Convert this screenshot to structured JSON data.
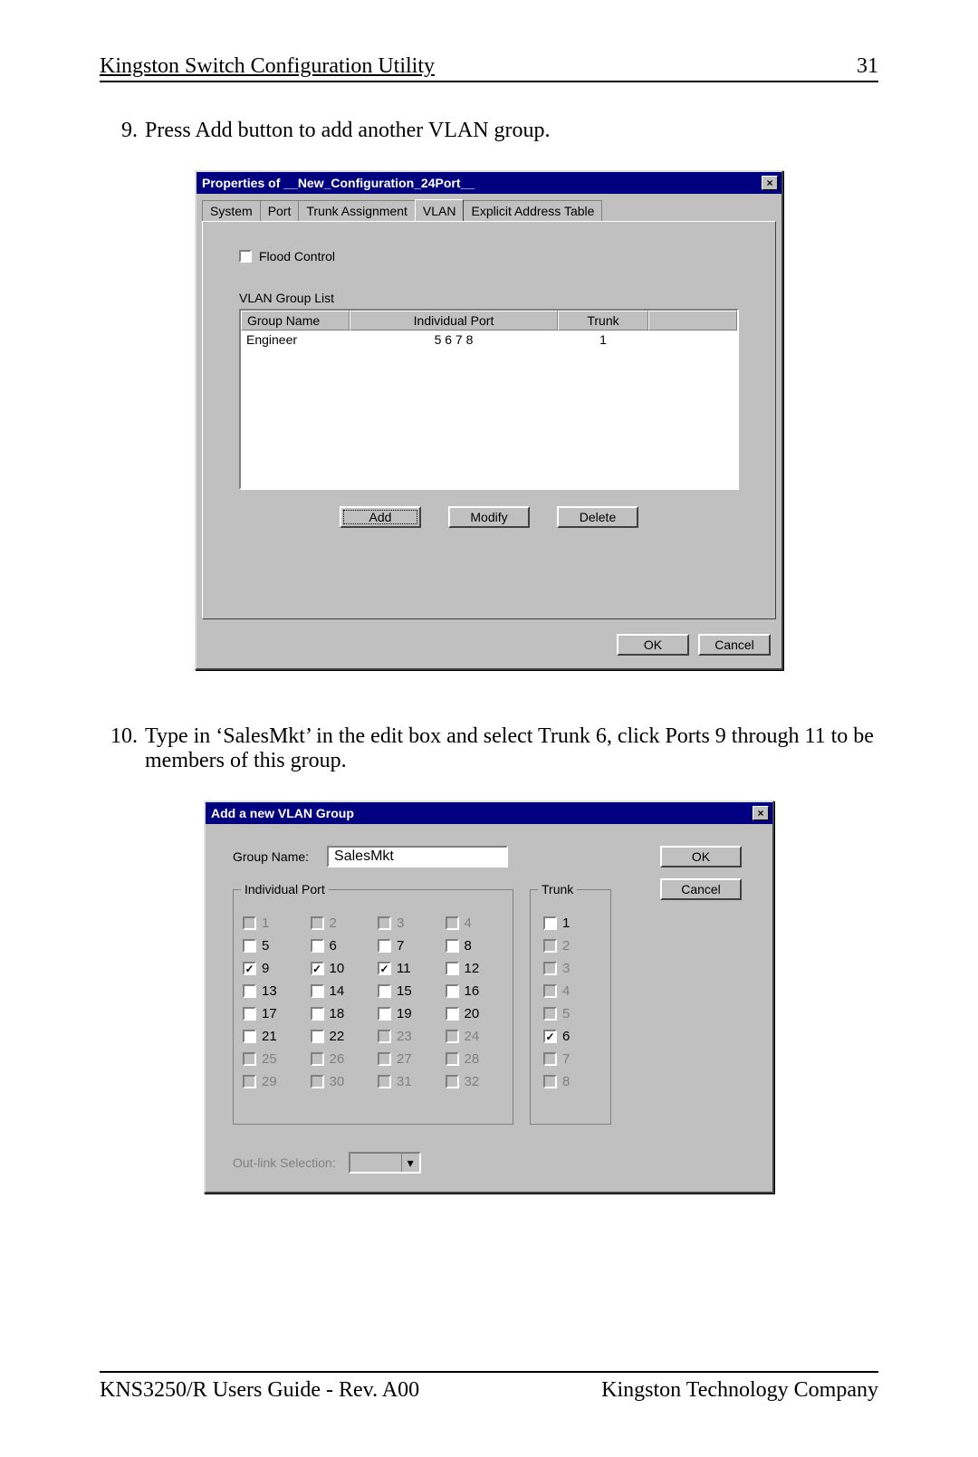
{
  "header": {
    "title": "Kingston Switch Configuration Utility",
    "page": "31"
  },
  "steps": {
    "s9": {
      "num": "9.",
      "text": "Press Add button to add another VLAN group."
    },
    "s10": {
      "num": "10.",
      "text": "Type in ‘SalesMkt’ in the edit box and select Trunk 6, click Ports 9 through 11 to be members of this group."
    }
  },
  "dlg1": {
    "title": "Properties of __New_Configuration_24Port__",
    "tabs": {
      "t0": "System",
      "t1": "Port",
      "t2": "Trunk Assignment",
      "t3": "VLAN",
      "t4": "Explicit Address Table"
    },
    "flood_label": "Flood Control",
    "list_label": "VLAN Group List",
    "cols": {
      "a": "Group Name",
      "b": "Individual Port",
      "c": "Trunk"
    },
    "row1": {
      "a": "Engineer",
      "b": "5  6  7  8",
      "c": "1"
    },
    "buttons": {
      "add": "Add",
      "modify": "Modify",
      "delete": "Delete",
      "ok": "OK",
      "cancel": "Cancel"
    }
  },
  "dlg2": {
    "title": "Add a new VLAN Group",
    "group_name_label": "Group Name:",
    "group_name_value": "SalesMkt",
    "individual_port_label": "Individual Port",
    "trunk_label": "Trunk",
    "outlink_label": "Out-link Selection:",
    "buttons": {
      "ok": "OK",
      "cancel": "Cancel"
    },
    "ports": [
      {
        "n": "1",
        "d": true,
        "c": false
      },
      {
        "n": "2",
        "d": true,
        "c": false
      },
      {
        "n": "3",
        "d": true,
        "c": false
      },
      {
        "n": "4",
        "d": true,
        "c": false
      },
      {
        "n": "5",
        "d": false,
        "c": false
      },
      {
        "n": "6",
        "d": false,
        "c": false
      },
      {
        "n": "7",
        "d": false,
        "c": false
      },
      {
        "n": "8",
        "d": false,
        "c": false
      },
      {
        "n": "9",
        "d": false,
        "c": true
      },
      {
        "n": "10",
        "d": false,
        "c": true
      },
      {
        "n": "11",
        "d": false,
        "c": true
      },
      {
        "n": "12",
        "d": false,
        "c": false
      },
      {
        "n": "13",
        "d": false,
        "c": false
      },
      {
        "n": "14",
        "d": false,
        "c": false
      },
      {
        "n": "15",
        "d": false,
        "c": false
      },
      {
        "n": "16",
        "d": false,
        "c": false
      },
      {
        "n": "17",
        "d": false,
        "c": false
      },
      {
        "n": "18",
        "d": false,
        "c": false
      },
      {
        "n": "19",
        "d": false,
        "c": false
      },
      {
        "n": "20",
        "d": false,
        "c": false
      },
      {
        "n": "21",
        "d": false,
        "c": false
      },
      {
        "n": "22",
        "d": false,
        "c": false
      },
      {
        "n": "23",
        "d": true,
        "c": false
      },
      {
        "n": "24",
        "d": true,
        "c": false
      },
      {
        "n": "25",
        "d": true,
        "c": false
      },
      {
        "n": "26",
        "d": true,
        "c": false
      },
      {
        "n": "27",
        "d": true,
        "c": false
      },
      {
        "n": "28",
        "d": true,
        "c": false
      },
      {
        "n": "29",
        "d": true,
        "c": false
      },
      {
        "n": "30",
        "d": true,
        "c": false
      },
      {
        "n": "31",
        "d": true,
        "c": false
      },
      {
        "n": "32",
        "d": true,
        "c": false
      }
    ],
    "trunks": [
      {
        "n": "1",
        "d": false,
        "c": false
      },
      {
        "n": "2",
        "d": true,
        "c": false
      },
      {
        "n": "3",
        "d": true,
        "c": false
      },
      {
        "n": "4",
        "d": true,
        "c": false
      },
      {
        "n": "5",
        "d": true,
        "c": false
      },
      {
        "n": "6",
        "d": false,
        "c": true
      },
      {
        "n": "7",
        "d": true,
        "c": false
      },
      {
        "n": "8",
        "d": true,
        "c": false
      }
    ]
  },
  "footer": {
    "left": "KNS3250/R Users Guide - Rev. A00",
    "right": "Kingston Technology Company"
  }
}
